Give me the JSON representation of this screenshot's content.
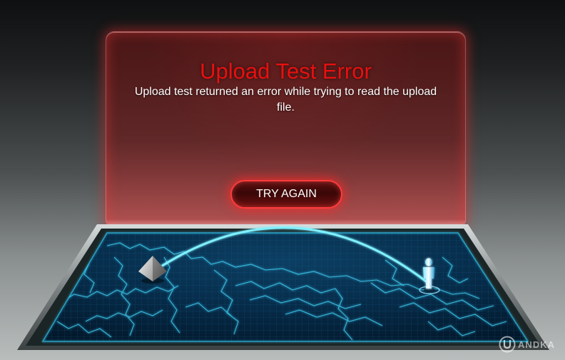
{
  "error_panel": {
    "title": "Upload Test Error",
    "message": "Upload test returned an error while trying to read the upload file.",
    "retry_button_label": "TRY AGAIN"
  },
  "map": {
    "server_marker_icon": "pyramid-icon",
    "user_marker_icon": "person-icon",
    "connection_icon": "arc-icon"
  },
  "watermark": {
    "text": "ANDKA",
    "icon": "u-logo-icon"
  },
  "colors": {
    "error_red": "#e81010",
    "map_glow": "#2bd6ff",
    "panel_tint": "#8c2222"
  }
}
